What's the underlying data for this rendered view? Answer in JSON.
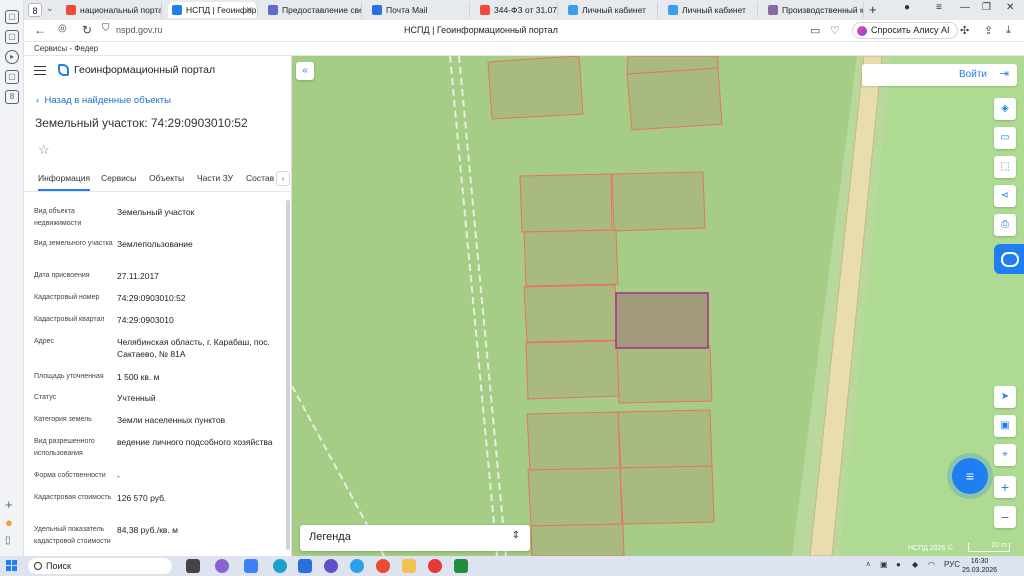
{
  "browser": {
    "tab_count": "8",
    "tabs": [
      {
        "label": "национальный портал",
        "color": "#f04a3e",
        "active": false
      },
      {
        "label": "НСПД | Геоинформа",
        "color": "#1e7ef2",
        "active": true
      },
      {
        "label": "Предоставление сведе",
        "color": "#5b6cc9",
        "active": false
      },
      {
        "label": "Почта Mail",
        "color": "#2b6fe8",
        "active": false
      },
      {
        "label": "344-ФЗ от 31.07.2025 -",
        "color": "#f04a3e",
        "active": false
      },
      {
        "label": "Личный кабинет",
        "color": "#39a0ef",
        "active": false
      },
      {
        "label": "Личный кабинет",
        "color": "#39a0ef",
        "active": false
      },
      {
        "label": "Производственный ка",
        "color": "#8a6a9a",
        "active": false
      }
    ],
    "url": "nspd.gov.ru",
    "page_title": "НСПД | Геоинформационный портал",
    "alice_label": "Спросить Алису AI",
    "bookmark": "Сервисы - Федер"
  },
  "panel": {
    "portal_name": "Геоинформационный портал",
    "back_label": "Назад в найденные объекты",
    "object_title": "Земельный участок: 74:29:0903010:52",
    "tabs": [
      "Информация",
      "Сервисы",
      "Объекты",
      "Части ЗУ",
      "Состав"
    ],
    "rows": [
      {
        "label": "Вид объекта недвижимости",
        "value": "Земельный участок"
      },
      {
        "label": "Вид земельного участка",
        "value": "Землепользование"
      },
      {
        "label": "Дата присвоения",
        "value": "27.11.2017"
      },
      {
        "label": "Кадастровый номер",
        "value": "74:29:0903010:52"
      },
      {
        "label": "Кадастровый квартал",
        "value": "74:29:0903010"
      },
      {
        "label": "Адрес",
        "value": "Челябинская область, г. Карабаш, пос. Сактаево, № 81А"
      },
      {
        "label": "Площадь уточненная",
        "value": "1 500 кв. м"
      },
      {
        "label": "Статус",
        "value": "Учтенный"
      },
      {
        "label": "Категория земель",
        "value": "Земли населенных пунктов"
      },
      {
        "label": "Вид разрешенного использования",
        "value": "ведение личного подсобного хозяйства"
      },
      {
        "label": "Форма собственности",
        "value": "-"
      },
      {
        "label": "Кадастровая стоимость",
        "value": "126 570 руб."
      },
      {
        "label": "Удельный показатель кадастровой стоимости",
        "value": "84,38 руб./кв. м"
      }
    ]
  },
  "map": {
    "login_label": "Войти",
    "legend_label": "Легенда",
    "copyright": "НСПД 2026 ©",
    "scale_label": "20 m",
    "colors": {
      "background": "#a5cd86",
      "parcel_fill": "#a9b37d",
      "parcel_stroke": "#e8745a",
      "selected_stroke": "#a62d8a",
      "selected_fill": "#a39a7e",
      "road": "#e9dcae"
    }
  },
  "taskbar": {
    "search_label": "Поиск",
    "lang": "РУС",
    "time": "16:30",
    "date": "25.03.2026"
  }
}
